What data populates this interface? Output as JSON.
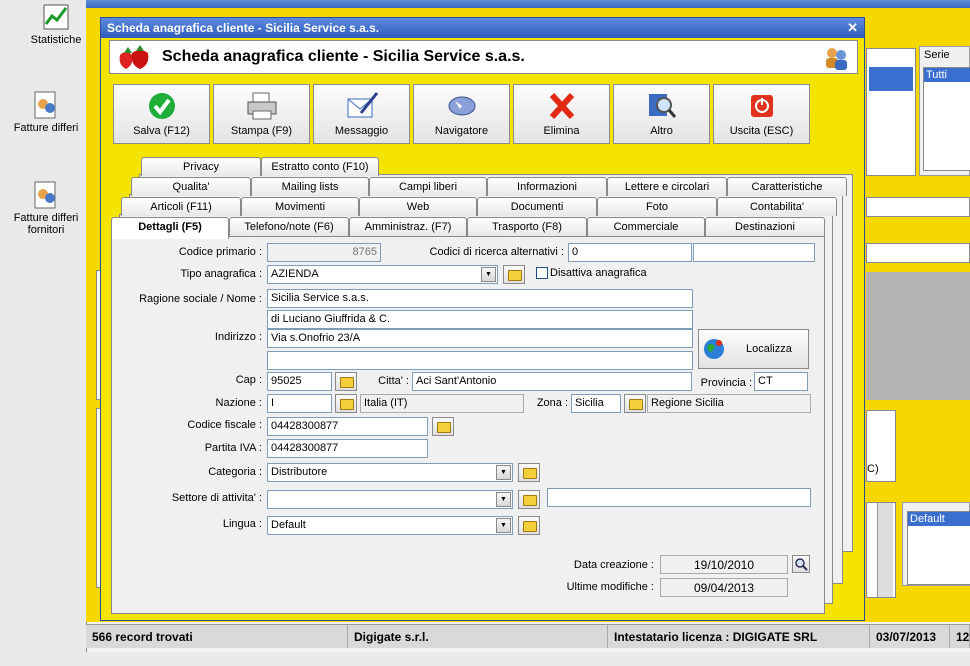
{
  "desktop": {
    "icons": [
      {
        "label": "Statistiche"
      },
      {
        "label": "Fatture differi"
      },
      {
        "label": "Fatture differi fornitori"
      }
    ]
  },
  "background": {
    "serie_label": "Serie",
    "serie_value": "Tutti",
    "list_default": "Default",
    "partial_text": "C)",
    "status": {
      "records": "566 record trovati",
      "company": "Digigate s.r.l.",
      "license": "Intestatario licenza : DIGIGATE SRL",
      "date": "03/07/2013",
      "extra": "12"
    }
  },
  "dialog": {
    "title": "Scheda anagrafica cliente - Sicilia Service s.a.s.",
    "header": "Scheda anagrafica cliente - Sicilia Service s.a.s.",
    "toolbar": [
      {
        "label": "Salva (F12)",
        "icon": "check-icon"
      },
      {
        "label": "Stampa (F9)",
        "icon": "printer-icon"
      },
      {
        "label": "Messaggio",
        "icon": "message-icon"
      },
      {
        "label": "Navigatore",
        "icon": "compass-icon"
      },
      {
        "label": "Elimina",
        "icon": "delete-x-icon"
      },
      {
        "label": "Altro",
        "icon": "magnifier-icon"
      },
      {
        "label": "Uscita (ESC)",
        "icon": "power-icon"
      }
    ],
    "tabs_row3": [
      "Privacy",
      "Estratto conto (F10)"
    ],
    "tabs_row2": [
      "Qualita'",
      "Mailing lists",
      "Campi liberi",
      "Informazioni",
      "Lettere e circolari",
      "Caratteristiche"
    ],
    "tabs_row1": [
      "Articoli (F11)",
      "Movimenti",
      "Web",
      "Documenti",
      "Foto",
      "Contabilita'"
    ],
    "tabs_row0": [
      "Dettagli (F5)",
      "Telefono/note (F6)",
      "Amministraz. (F7)",
      "Trasporto (F8)",
      "Commerciale",
      "Destinazioni"
    ],
    "form": {
      "codice_primario_label": "Codice primario :",
      "codice_primario": "8765",
      "codici_ricerca_label": "Codici di ricerca alternativi :",
      "codici_ricerca": "0",
      "tipo_label": "Tipo anagrafica :",
      "tipo": "AZIENDA",
      "disattiva_label": "Disattiva anagrafica",
      "ragione_label": "Ragione sociale / Nome :",
      "ragione1": "Sicilia Service s.a.s.",
      "ragione2": "di Luciano Giuffrida & C.",
      "indirizzo_label": "Indirizzo :",
      "indirizzo1": "Via s.Onofrio 23/A",
      "indirizzo2": "",
      "localizza": "Localizza",
      "cap_label": "Cap :",
      "cap": "95025",
      "citta_label": "Citta' :",
      "citta": "Aci Sant'Antonio",
      "provincia_label": "Provincia :",
      "provincia": "CT",
      "nazione_label": "Nazione :",
      "nazione": "I",
      "nazione_desc": "Italia (IT)",
      "zona_label": "Zona :",
      "zona": "Sicilia",
      "zona_desc": "Regione Sicilia",
      "cf_label": "Codice fiscale :",
      "cf": "04428300877",
      "piva_label": "Partita IVA :",
      "piva": "04428300877",
      "categoria_label": "Categoria :",
      "categoria": "Distributore",
      "settore_label": "Settore di attivita' :",
      "settore": "",
      "lingua_label": "Lingua :",
      "lingua": "Default",
      "data_creazione_label": "Data creazione :",
      "data_creazione": "19/10/2010",
      "ultime_label": "Ultime modifiche :",
      "ultime": "09/04/2013"
    }
  }
}
